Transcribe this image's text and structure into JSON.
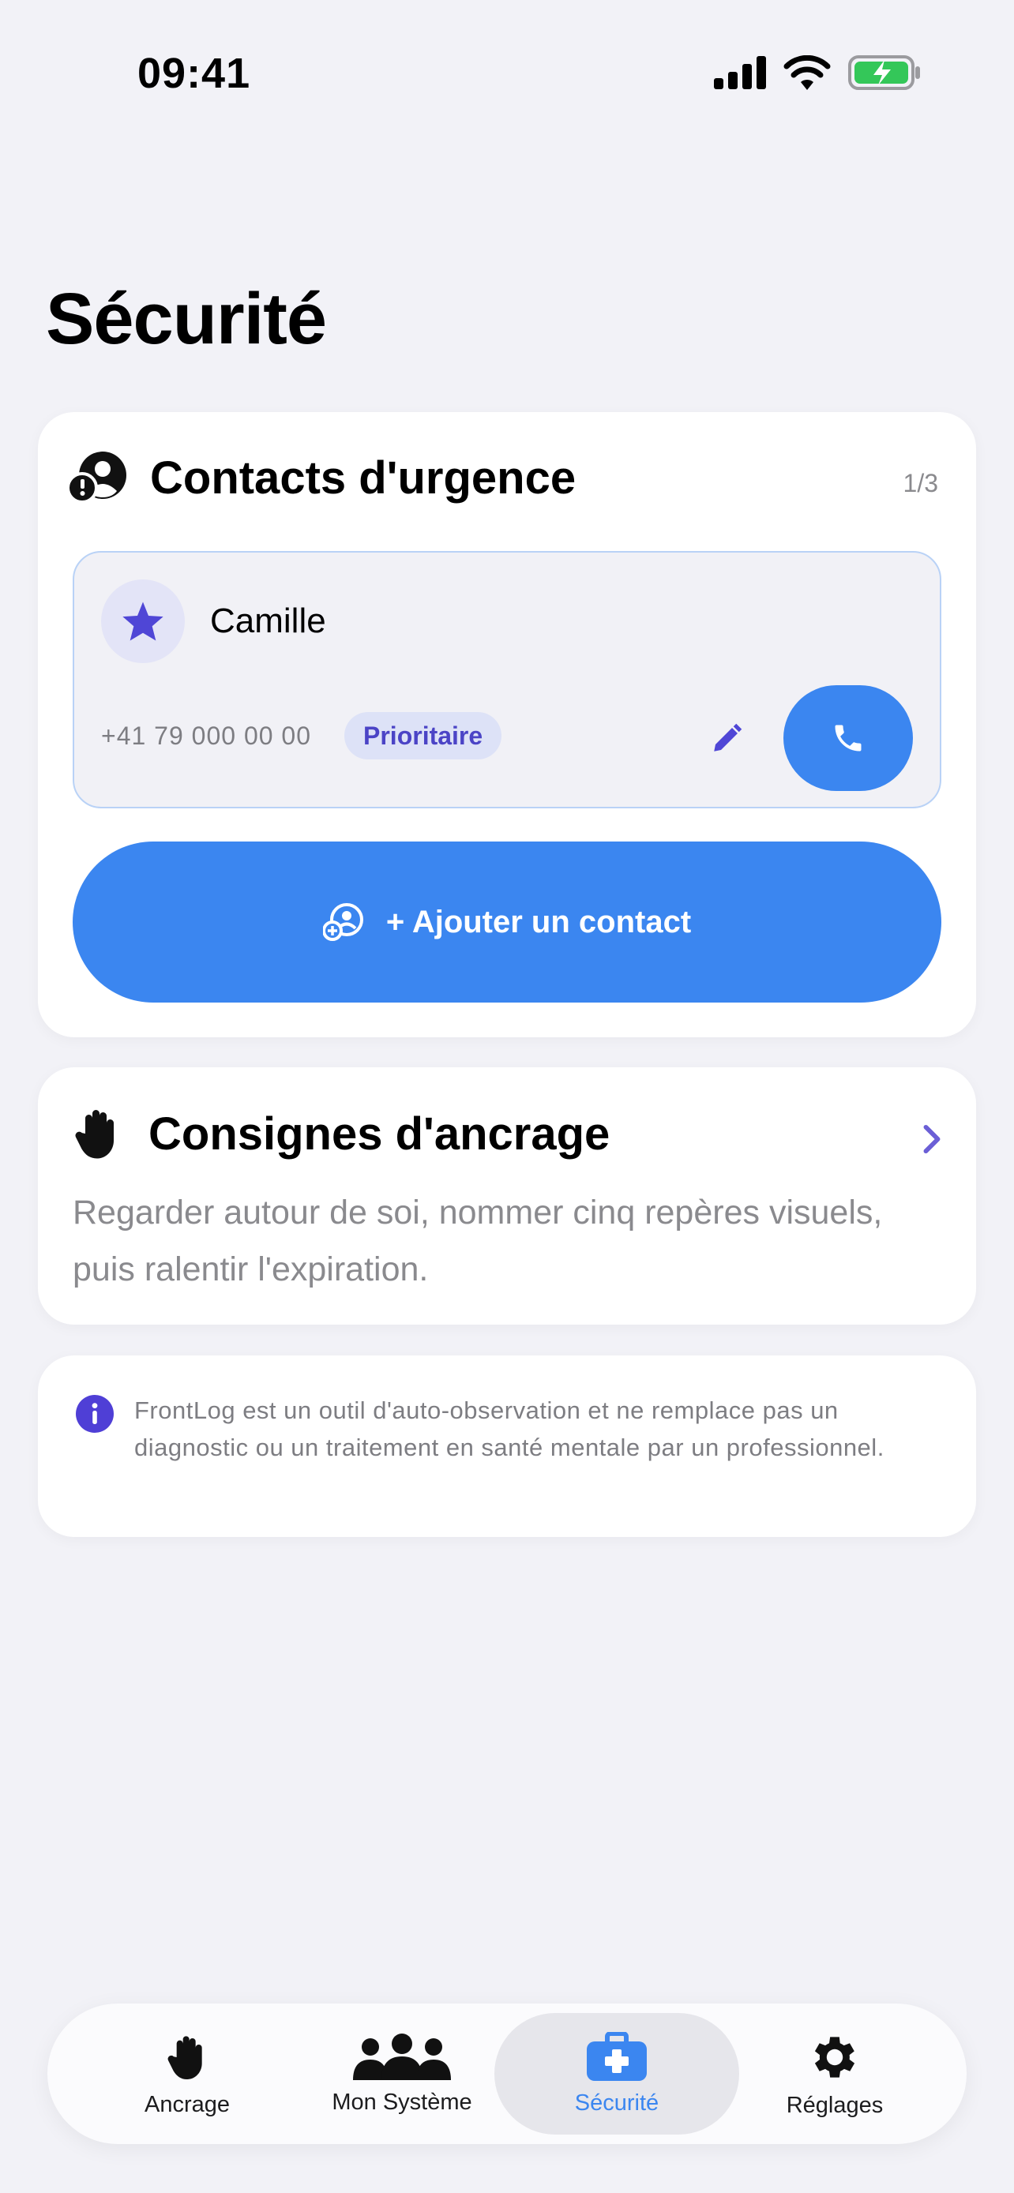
{
  "status_bar": {
    "time": "09:41",
    "icons": [
      "signal-icon",
      "wifi-icon",
      "battery-charging-icon"
    ]
  },
  "page": {
    "title": "Sécurité"
  },
  "emergency_contacts": {
    "title": "Contacts d'urgence",
    "icon": "emergency-person-icon",
    "count": "1/3",
    "contacts": [
      {
        "name": "Camille",
        "phone": "+41 79 000 00 00",
        "badge": "Prioritaire",
        "icon": "star-icon"
      }
    ],
    "add_button_label": "+ Ajouter un contact"
  },
  "grounding": {
    "title": "Consignes d'ancrage",
    "icon": "hand-icon",
    "text": "Regarder autour de soi, nommer cinq repères visuels, puis ralentir l'expiration."
  },
  "disclaimer": {
    "icon": "info-icon",
    "text": "FrontLog est un outil d'auto-observation et ne remplace pas un diagnostic ou un traitement en santé mentale par un professionnel."
  },
  "tab_bar": {
    "items": [
      {
        "label": "Ancrage",
        "icon": "hand-icon",
        "active": false
      },
      {
        "label": "Mon Système",
        "icon": "group-icon",
        "active": false
      },
      {
        "label": "Sécurité",
        "icon": "medical-kit-icon",
        "active": true
      },
      {
        "label": "Réglages",
        "icon": "gear-icon",
        "active": false
      }
    ]
  },
  "colors": {
    "accent": "#3b86f0",
    "badge_text": "#4b44c6",
    "badge_bg": "#dde2f7",
    "background": "#f2f2f7",
    "battery_green": "#34c759"
  }
}
